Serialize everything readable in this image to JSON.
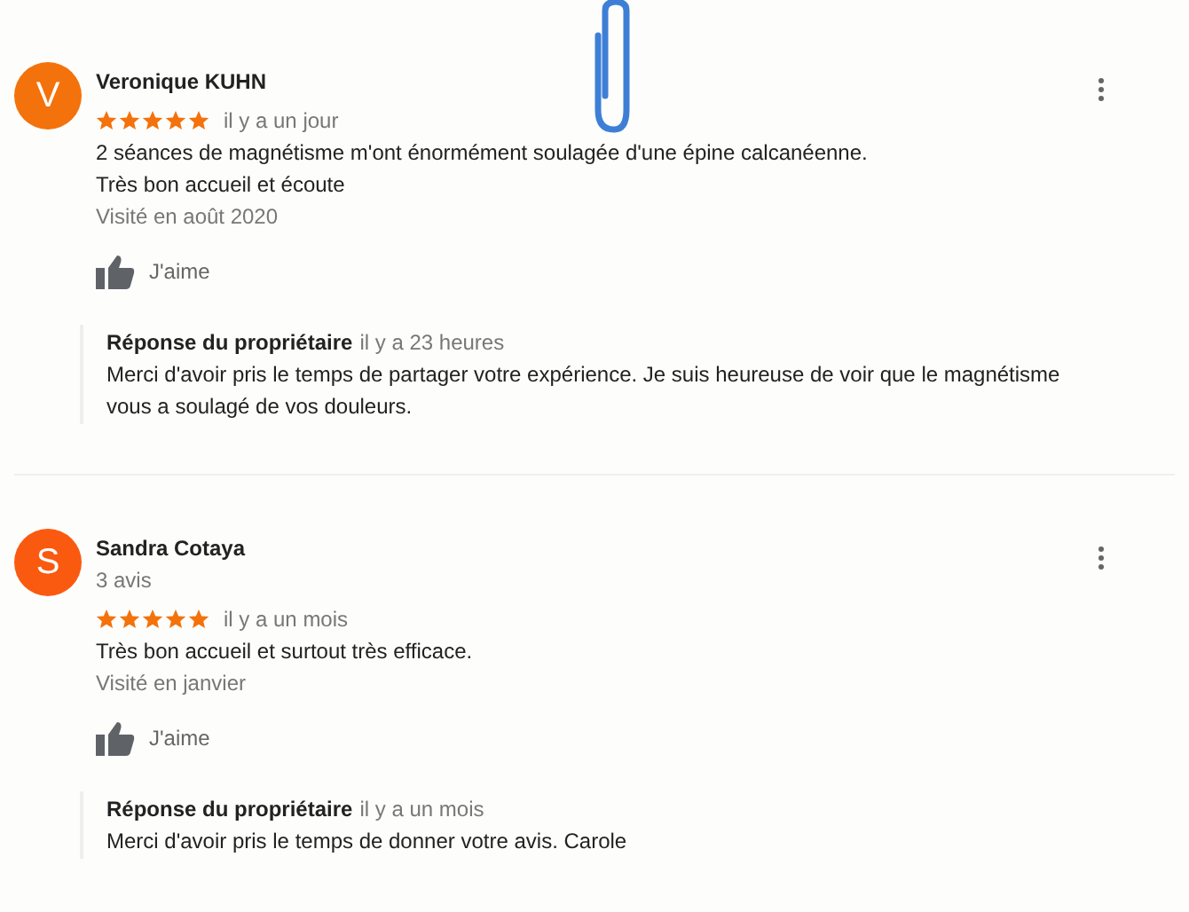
{
  "reviews": [
    {
      "avatar_letter": "V",
      "color": "#f4720b",
      "name": "Veronique KUHN",
      "stars": 5,
      "time": "il y a un jour",
      "text": [
        "2 séances de magnétisme m'ont énormément soulagée d'une épine calcanéenne.",
        "Très bon accueil et écoute"
      ],
      "visited": "Visité en août 2020",
      "like": "J'aime",
      "response": {
        "label": "Réponse du propriétaire",
        "time": "il y a 23 heures",
        "text": "Merci d'avoir pris le temps de partager votre expérience. Je suis heureuse de voir que le magnétisme vous a soulagé de vos douleurs."
      }
    },
    {
      "avatar_letter": "S",
      "color": "#fa5a0f",
      "name": "Sandra Cotaya",
      "review_count": "3 avis",
      "stars": 5,
      "time": "il y a un mois",
      "text": [
        "Très bon accueil et surtout très efficace."
      ],
      "visited": "Visité en janvier",
      "like": "J'aime",
      "response": {
        "label": "Réponse du propriétaire",
        "time": "il y a un mois",
        "text": "Merci d'avoir pris le temps de donner votre avis. Carole"
      }
    }
  ]
}
